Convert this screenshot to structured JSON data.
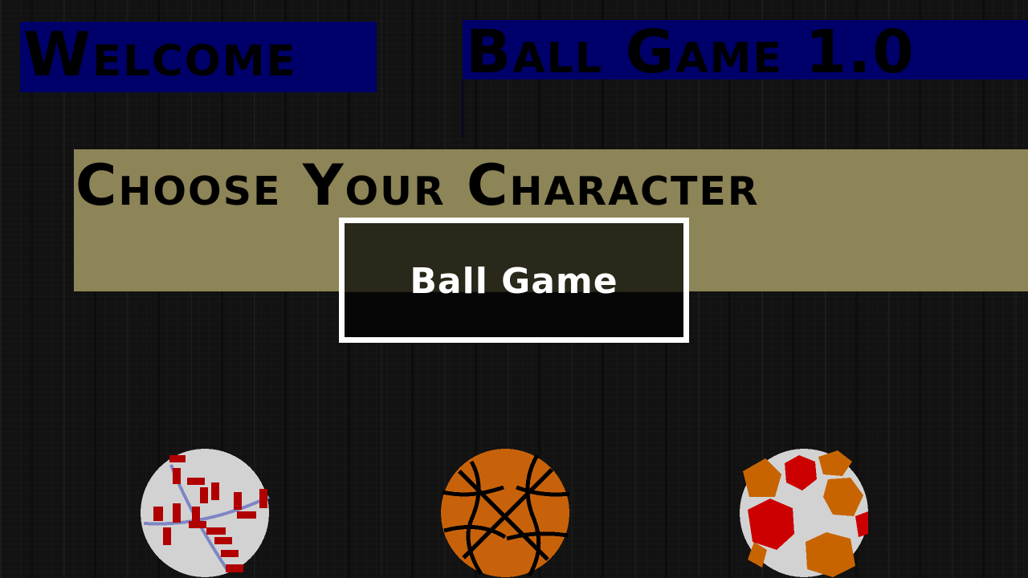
{
  "screen": {
    "welcome_label": "Welcome",
    "title_label": "Ball Game 1.0",
    "choose_label": "Choose Your Character"
  },
  "overlay": {
    "title": "Ball Game"
  },
  "characters": [
    {
      "icon": "baseball-icon"
    },
    {
      "icon": "basketball-icon"
    },
    {
      "icon": "soccer-ball-icon"
    }
  ],
  "colors": {
    "banner_blue": "#00006a",
    "banner_khaki": "#8d8457",
    "baseball_leather": "#d2d2d2",
    "baseball_stitch": "#b00000",
    "basketball_orange": "#c8620a",
    "soccer_red": "#cc0000",
    "soccer_orange": "#c86400"
  }
}
